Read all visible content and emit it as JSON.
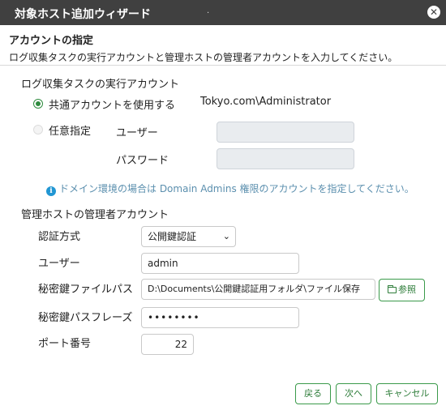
{
  "window": {
    "title": "対象ホスト追加ウィザード",
    "dot": "."
  },
  "section": {
    "title": "アカウントの指定",
    "description": "ログ収集タスクの実行アカウントと管理ホストの管理者アカウントを入力してください。"
  },
  "exec_account": {
    "title": "ログ収集タスクの実行アカウント",
    "shared_label": "共通アカウントを使用する",
    "shared_value": "Tokyo.com\\Administrator",
    "custom_label": "任意指定",
    "user_label": "ユーザー",
    "password_label": "パスワード",
    "user_value": "",
    "password_value": ""
  },
  "info": {
    "icon": "i",
    "text": "ドメイン環境の場合は Domain Admins 権限のアカウントを指定してください。"
  },
  "admin_account": {
    "title": "管理ホストの管理者アカウント",
    "auth_label": "認証方式",
    "auth_value": "公開鍵認証",
    "user_label": "ユーザー",
    "user_value": "admin",
    "key_file_label": "秘密鍵ファイルパス",
    "key_file_value": "D:\\Documents\\公開鍵認証用フォルダ\\ファイル保存",
    "browse_label": "参照",
    "passphrase_label": "秘密鍵パスフレーズ",
    "passphrase_value": "••••••••",
    "port_label": "ポート番号",
    "port_value": "22"
  },
  "footer": {
    "back": "戻る",
    "next": "次へ",
    "cancel": "キャンセル"
  }
}
